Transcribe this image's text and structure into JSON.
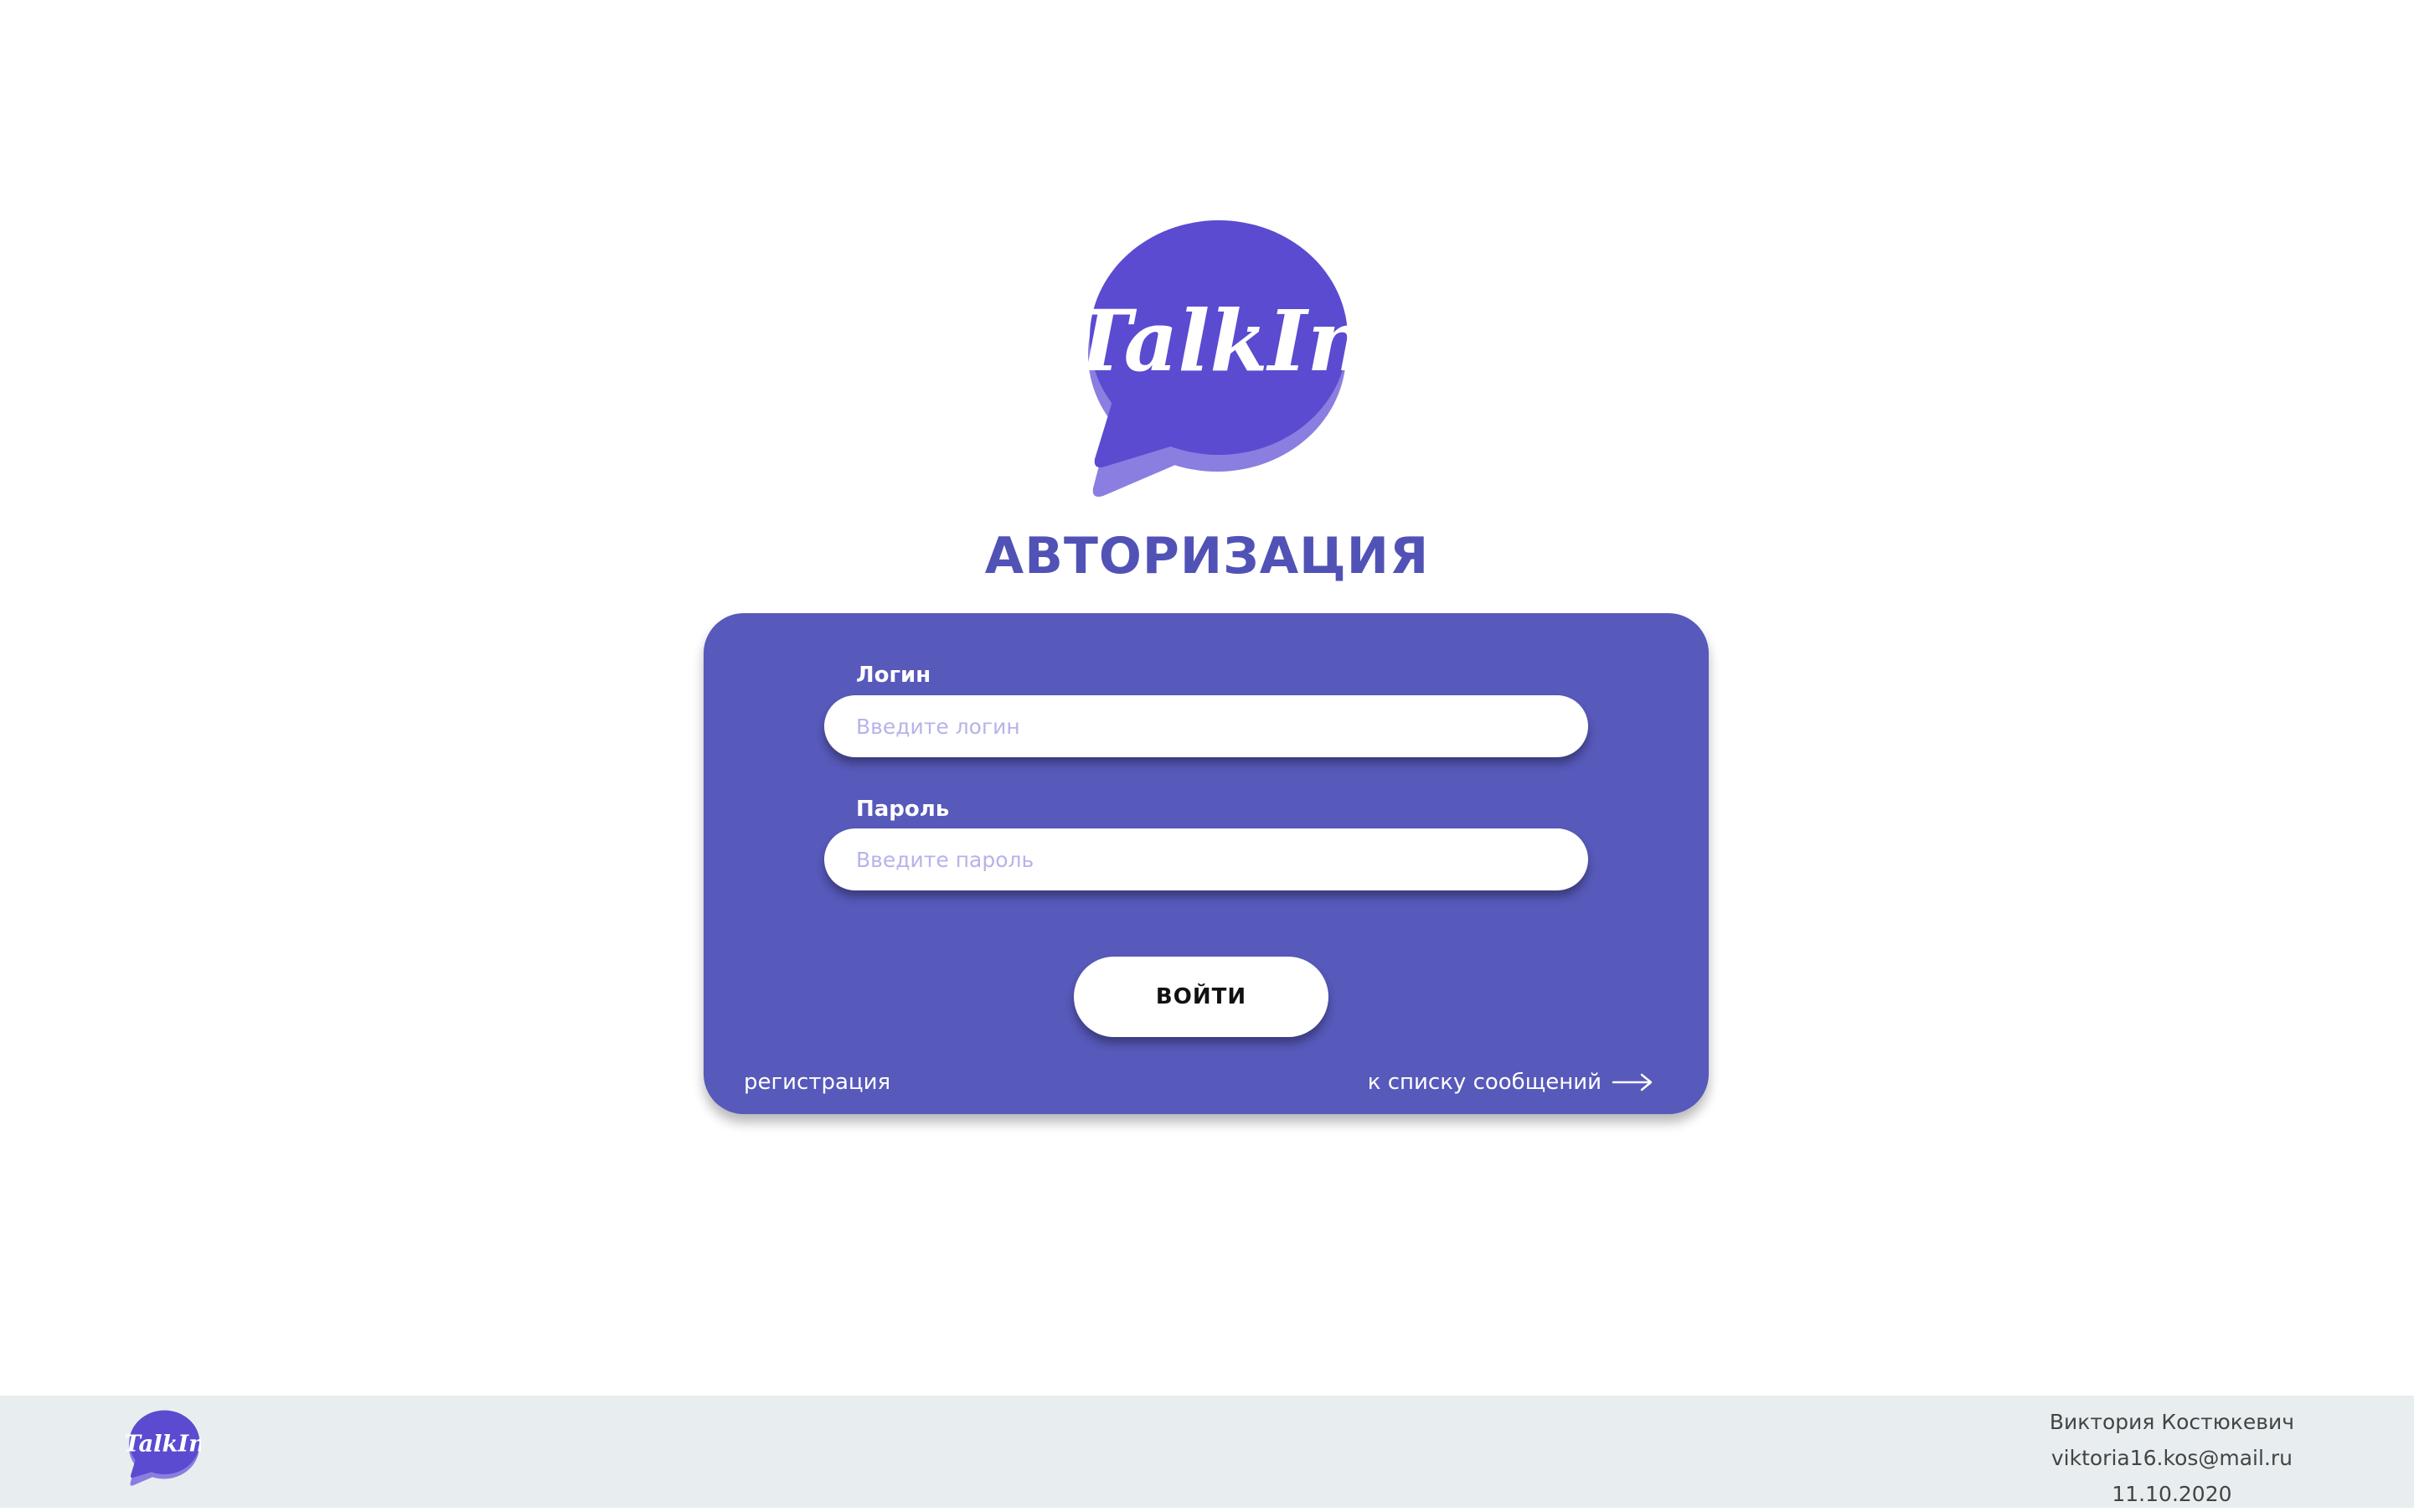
{
  "brand": {
    "logo_text": "TalkIn",
    "primary_color": "#5759bb",
    "logo_color": "#5a4bd0",
    "logo_shadow_color": "#8a7ee0"
  },
  "page": {
    "title": "АВТОРИЗАЦИЯ"
  },
  "form": {
    "login": {
      "label": "Логин",
      "placeholder": "Введите логин",
      "value": ""
    },
    "password": {
      "label": "Пароль",
      "placeholder": "Введите пароль",
      "value": ""
    },
    "submit_label": "ВОЙТИ",
    "register_link": "регистрация",
    "messages_link": "к списку сообщений",
    "messages_link_icon": "arrow-right-icon"
  },
  "footer": {
    "logo_text": "TalkIn",
    "author": "Виктория Костюкевич",
    "email": "viktoria16.kos@mail.ru",
    "date": "11.10.2020"
  }
}
